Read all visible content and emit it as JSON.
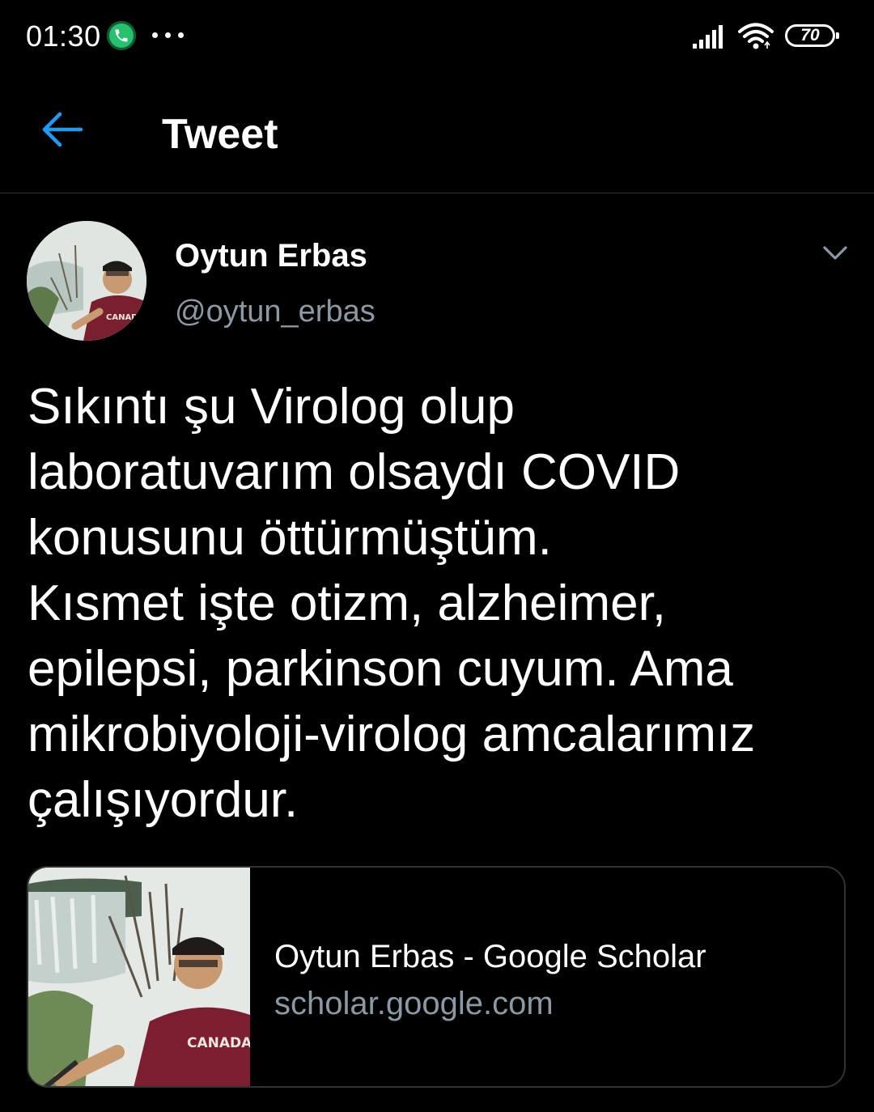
{
  "status_bar": {
    "time": "01:30",
    "battery": "70",
    "icons": [
      "call-in-progress-icon",
      "more-dots-icon",
      "signal-icon",
      "wifi-icon",
      "battery-icon"
    ]
  },
  "header": {
    "title": "Tweet",
    "back_icon": "arrow-left-icon"
  },
  "tweet": {
    "author_name": "Oytun Erbas",
    "author_handle": "@oytun_erbas",
    "text": "Sıkıntı şu Virolog olup\nlaboratuvarım olsaydı COVID\nkonusunu öttürmüştüm.\nKısmet işte otizm, alzheimer,\nepilepsi, parkinson cuyum. Ama\nmikrobiyoloji-virolog amcalarımız\nçalışıyordur.",
    "menu_icon": "chevron-down-icon"
  },
  "link_card": {
    "title": "Oytun Erbas - Google Scholar",
    "domain": "scholar.google.com",
    "sweater_text": "CANADA"
  },
  "colors": {
    "background": "#000000",
    "accent": "#1d9bf0",
    "secondary_text": "#8b98a5",
    "divider": "#2f3336",
    "call_green": "#24c26a"
  }
}
